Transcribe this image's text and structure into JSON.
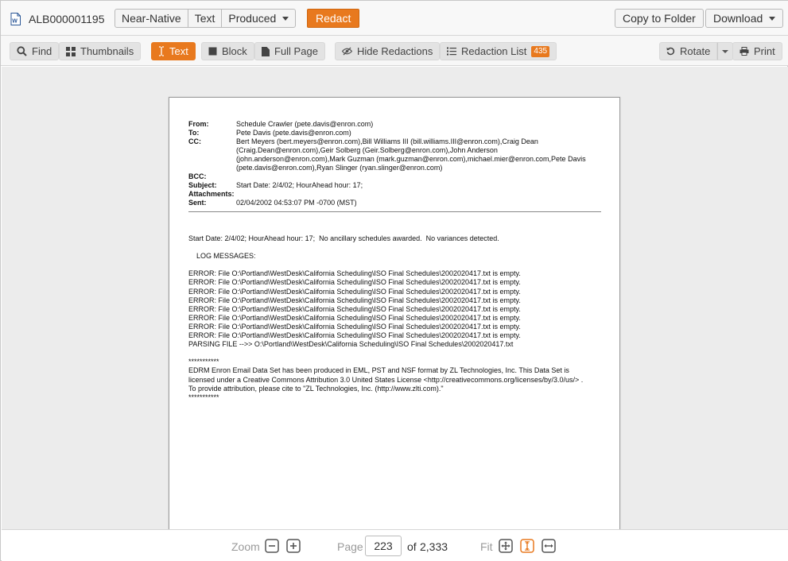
{
  "doc_id": "ALB000001195",
  "view_modes": [
    "Near-Native",
    "Text",
    "Produced"
  ],
  "redact_label": "Redact",
  "copy_to_folder_label": "Copy to Folder",
  "download_label": "Download",
  "toolbar": {
    "find": "Find",
    "thumbnails": "Thumbnails",
    "text": "Text",
    "block": "Block",
    "full_page": "Full Page",
    "hide_redactions": "Hide Redactions",
    "redaction_list": "Redaction List",
    "redaction_count": "435",
    "rotate": "Rotate",
    "print": "Print"
  },
  "email": {
    "labels": {
      "from": "From:",
      "to": "To:",
      "cc": "CC:",
      "bcc": "BCC:",
      "subject": "Subject:",
      "attachments": "Attachments:",
      "sent": "Sent:"
    },
    "from": "Schedule Crawler (pete.davis@enron.com)",
    "to": "Pete Davis (pete.davis@enron.com)",
    "cc": "Bert Meyers (bert.meyers@enron.com),Bill Williams III (bill.williams.III@enron.com),Craig Dean (Craig.Dean@enron.com),Geir Solberg (Geir.Solberg@enron.com),John Anderson (john.anderson@enron.com),Mark Guzman (mark.guzman@enron.com),michael.mier@enron.com,Pete Davis (pete.davis@enron.com),Ryan Slinger (ryan.slinger@enron.com)",
    "bcc": "",
    "subject": "Start Date: 2/4/02; HourAhead hour: 17;",
    "attachments": "",
    "sent": "02/04/2002 04:53:07 PM -0700 (MST)",
    "body_lines": [
      "Start Date: 2/4/02; HourAhead hour: 17;  No ancillary schedules awarded.  No variances detected.",
      "",
      "    LOG MESSAGES:",
      "",
      "ERROR: File O:\\Portland\\WestDesk\\California Scheduling\\ISO Final Schedules\\2002020417.txt is empty.",
      "ERROR: File O:\\Portland\\WestDesk\\California Scheduling\\ISO Final Schedules\\2002020417.txt is empty.",
      "ERROR: File O:\\Portland\\WestDesk\\California Scheduling\\ISO Final Schedules\\2002020417.txt is empty.",
      "ERROR: File O:\\Portland\\WestDesk\\California Scheduling\\ISO Final Schedules\\2002020417.txt is empty.",
      "ERROR: File O:\\Portland\\WestDesk\\California Scheduling\\ISO Final Schedules\\2002020417.txt is empty.",
      "ERROR: File O:\\Portland\\WestDesk\\California Scheduling\\ISO Final Schedules\\2002020417.txt is empty.",
      "ERROR: File O:\\Portland\\WestDesk\\California Scheduling\\ISO Final Schedules\\2002020417.txt is empty.",
      "ERROR: File O:\\Portland\\WestDesk\\California Scheduling\\ISO Final Schedules\\2002020417.txt is empty.",
      "PARSING FILE -->> O:\\Portland\\WestDesk\\California Scheduling\\ISO Final Schedules\\2002020417.txt",
      "",
      "***********",
      "EDRM Enron Email Data Set has been produced in EML, PST and NSF format by ZL Technologies, Inc. This Data Set is licensed under a Creative Commons Attribution 3.0 United States License <http://creativecommons.org/licenses/by/3.0/us/> . To provide attribution, please cite to \"ZL Technologies, Inc. (http://www.zlti.com).\"",
      "***********"
    ]
  },
  "footer": {
    "zoom_label": "Zoom",
    "page_label": "Page",
    "current_page": "223",
    "of_label": "of",
    "total_pages": "2,333",
    "fit_label": "Fit"
  },
  "colors": {
    "accent": "#e8791e",
    "doc_icon": "#2b5797"
  }
}
